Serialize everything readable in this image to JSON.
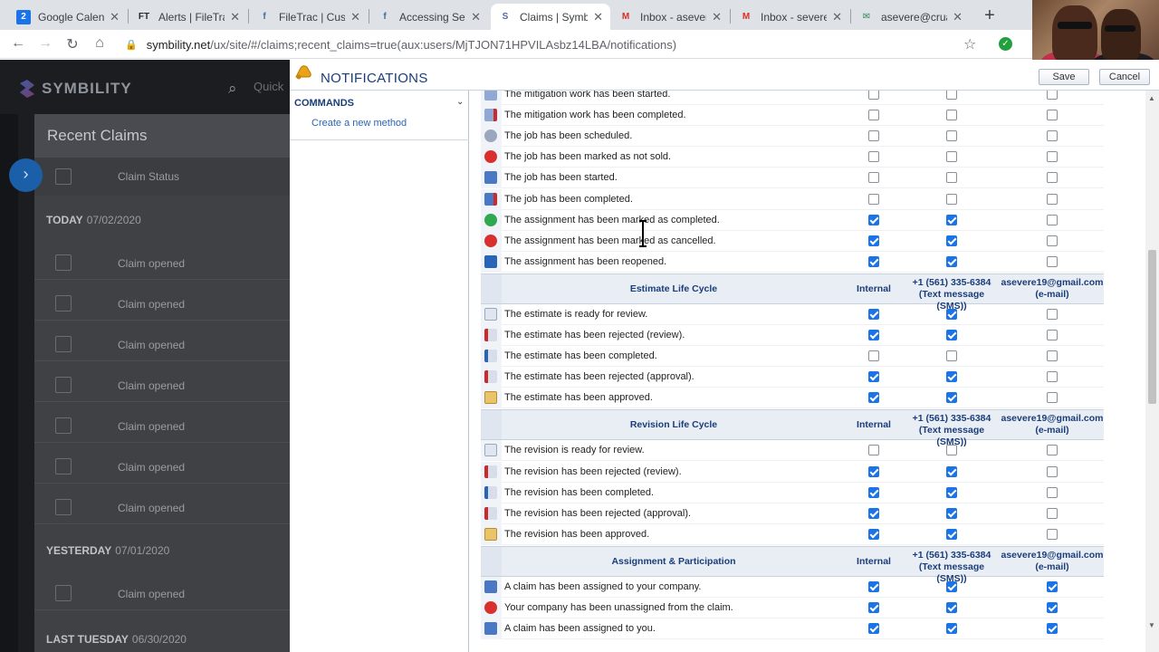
{
  "browser": {
    "tabs": [
      {
        "title": "Google Calend",
        "favicon": "calendar-icon",
        "badge": "2",
        "color": "#1a73e8"
      },
      {
        "title": "Alerts | FileTrac",
        "favicon": "filetrac-icon",
        "badge": "FT",
        "color": "#2b2b2b"
      },
      {
        "title": "FileTrac | Custo",
        "favicon": "filetrac-icon",
        "badge": "f",
        "color": "#3a6ea5"
      },
      {
        "title": "Accessing Setti",
        "favicon": "filetrac-icon",
        "badge": "f",
        "color": "#3a6ea5"
      },
      {
        "title": "Claims | Symbil",
        "favicon": "symbility-icon",
        "badge": "S",
        "color": "#5566aa"
      },
      {
        "title": "Inbox - asevere",
        "favicon": "gmail-icon",
        "badge": "M",
        "color": "#d93025"
      },
      {
        "title": "Inbox - severe",
        "favicon": "gmail-icon",
        "badge": "M",
        "color": "#d93025"
      },
      {
        "title": "asevere@crua",
        "favicon": "mail-icon",
        "badge": "✉",
        "color": "#2e8b57"
      }
    ],
    "url_host": "symbility.net",
    "url_path": "/ux/site/#/claims;recent_claims=true(aux:users/MjTJON71HPVILAsbz14LBA/notifications)"
  },
  "app": {
    "brand": "SYMBILITY",
    "search_placeholder": "Quick",
    "panel_title": "Recent Claims",
    "column_header": "Claim Status",
    "groups": [
      {
        "day": "TODAY",
        "date": "07/02/2020",
        "items": [
          "Claim opened",
          "Claim opened",
          "Claim opened",
          "Claim opened",
          "Claim opened",
          "Claim opened",
          "Claim opened"
        ]
      },
      {
        "day": "YESTERDAY",
        "date": "07/01/2020",
        "items": [
          "Claim opened"
        ]
      },
      {
        "day": "LAST TUESDAY",
        "date": "06/30/2020",
        "items": []
      }
    ]
  },
  "modal": {
    "title": "NOTIFICATIONS",
    "save_label": "Save",
    "cancel_label": "Cancel",
    "commands_label": "COMMANDS",
    "create_method_label": "Create a new method",
    "col_internal": "Internal",
    "col_sms_line1": "+1 (561) 335-6384",
    "col_sms_line2": "(Text message (SMS))",
    "col_email_line1": "asevere19@gmail.com",
    "col_email_line2": "(e-mail)",
    "rows_top": [
      {
        "label": "The mitigation work has been started.",
        "icon": "mitigation-icon",
        "checks": [
          false,
          false,
          false
        ]
      },
      {
        "label": "The mitigation work has been completed.",
        "icon": "mitigation-done-icon",
        "checks": [
          false,
          false,
          false
        ]
      },
      {
        "label": "The job has been scheduled.",
        "icon": "clock-icon",
        "checks": [
          false,
          false,
          false
        ]
      },
      {
        "label": "The job has been marked as not sold.",
        "icon": "red-x-icon",
        "checks": [
          false,
          false,
          false
        ]
      },
      {
        "label": "The job has been started.",
        "icon": "job-start-icon",
        "checks": [
          false,
          false,
          false
        ]
      },
      {
        "label": "The job has been completed.",
        "icon": "job-done-icon",
        "checks": [
          false,
          false,
          false
        ]
      },
      {
        "label": "The assignment has been marked as completed.",
        "icon": "green-check-icon",
        "checks": [
          true,
          true,
          false
        ]
      },
      {
        "label": "The assignment has been marked as cancelled.",
        "icon": "red-x-icon",
        "checks": [
          true,
          true,
          false
        ]
      },
      {
        "label": "The assignment has been reopened.",
        "icon": "reopen-icon",
        "checks": [
          true,
          true,
          false
        ]
      }
    ],
    "sections": [
      {
        "title": "Estimate Life Cycle",
        "rows": [
          {
            "label": "The estimate is ready for review.",
            "icon": "document-icon",
            "checks": [
              true,
              true,
              false
            ]
          },
          {
            "label": "The estimate has been rejected (review).",
            "icon": "document-reject-icon",
            "checks": [
              true,
              true,
              false
            ]
          },
          {
            "label": "The estimate has been completed.",
            "icon": "document-done-icon",
            "checks": [
              false,
              false,
              false
            ]
          },
          {
            "label": "The estimate has been rejected (approval).",
            "icon": "document-reject-icon",
            "checks": [
              true,
              true,
              false
            ]
          },
          {
            "label": "The estimate has been approved.",
            "icon": "document-approve-icon",
            "checks": [
              true,
              true,
              false
            ]
          }
        ]
      },
      {
        "title": "Revision Life Cycle",
        "rows": [
          {
            "label": "The revision is ready for review.",
            "icon": "document-icon",
            "checks": [
              false,
              false,
              false
            ]
          },
          {
            "label": "The revision has been rejected (review).",
            "icon": "document-reject-icon",
            "checks": [
              true,
              true,
              false
            ]
          },
          {
            "label": "The revision has been completed.",
            "icon": "document-done-icon",
            "checks": [
              true,
              true,
              false
            ]
          },
          {
            "label": "The revision has been rejected (approval).",
            "icon": "document-reject-icon",
            "checks": [
              true,
              true,
              false
            ]
          },
          {
            "label": "The revision has been approved.",
            "icon": "document-approve-icon",
            "checks": [
              true,
              true,
              false
            ]
          }
        ]
      },
      {
        "title": "Assignment & Participation",
        "rows": [
          {
            "label": "A claim has been assigned to your company.",
            "icon": "assign-icon",
            "checks": [
              true,
              true,
              true
            ]
          },
          {
            "label": "Your company has been unassigned from the claim.",
            "icon": "unassign-icon",
            "checks": [
              true,
              true,
              true
            ]
          },
          {
            "label": "A claim has been assigned to you.",
            "icon": "assign-icon",
            "checks": [
              true,
              true,
              true
            ]
          }
        ]
      }
    ]
  }
}
